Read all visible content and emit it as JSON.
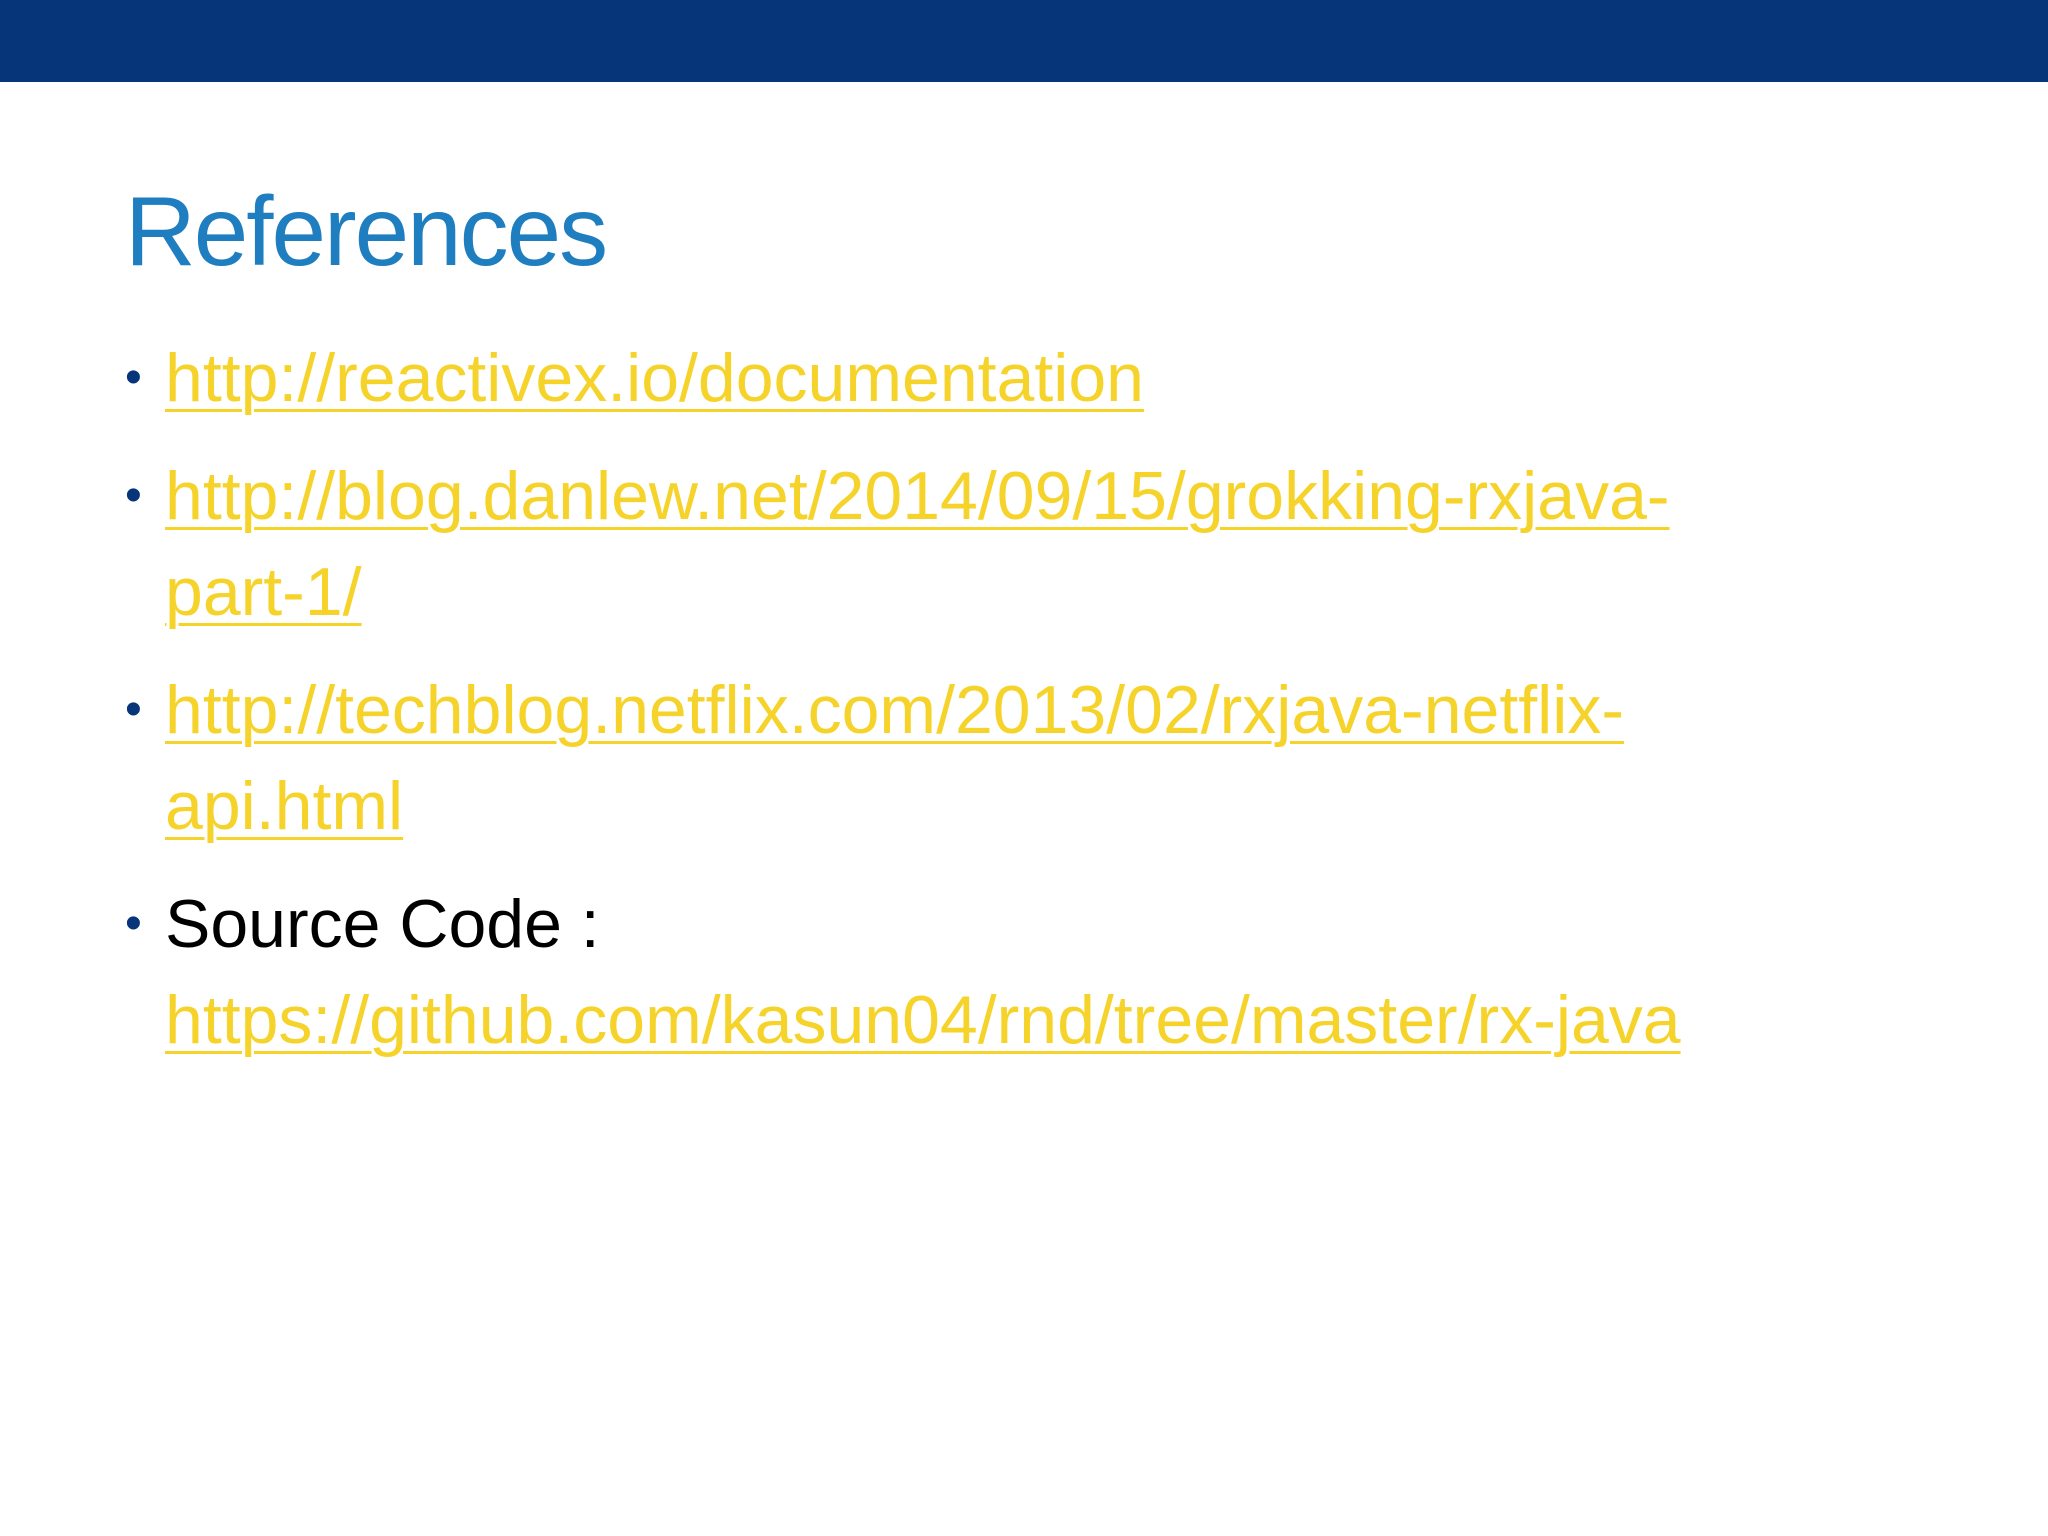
{
  "slide": {
    "title": "References",
    "colors": {
      "top_bar": "#073579",
      "title": "#1F7EBF",
      "link": "#F6D32A",
      "bullet": "#073579",
      "text": "#000000"
    },
    "references": [
      {
        "line1": "http://reactivex.io/documentation"
      },
      {
        "line1": "http://blog.danlew.net/2014/09/15/grokking-rxjava-",
        "line2": "part-1/"
      },
      {
        "line1": "http://techblog.netflix.com/2013/02/rxjava-netflix-",
        "line2": "api.html"
      }
    ],
    "source_code": {
      "label": "Source Code :",
      "link": "https://github.com/kasun04/rnd/tree/master/rx-java"
    },
    "bullet_glyph": "•"
  }
}
